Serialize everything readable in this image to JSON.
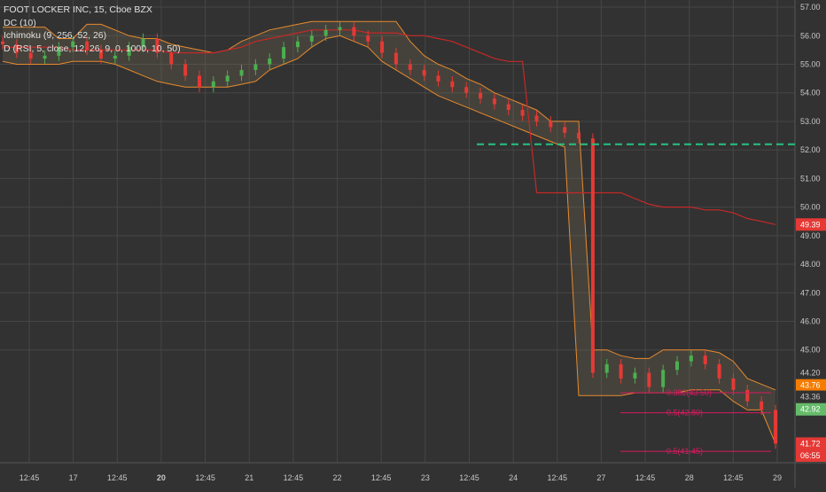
{
  "legend": {
    "title": "FOOT LOCKER INC, 15, Cboe BZX",
    "dc": "DC (10)",
    "ichimoku": "Ichimoku (9, 256, 52, 26)",
    "d": "D (RSI, 5, close, 12, 26, 9, 0, 1000, 10, 50)"
  },
  "colors": {
    "background": "#323232",
    "grid": "#464646",
    "candle_up": "#4caf50",
    "candle_down": "#e53935",
    "donchian": "#e88a2e",
    "ichimoku_line": "#c62828",
    "ichimoku_cloud": "#8a7a5a",
    "target_line": "#26c281",
    "fib": "#d81b60"
  },
  "chart_data": {
    "type": "line",
    "title": "FOOT LOCKER INC, 15, Cboe BZX",
    "ylim": [
      41.05,
      57.25
    ],
    "y_ticks": [
      "57.00",
      "56.00",
      "55.00",
      "54.00",
      "53.00",
      "52.00",
      "51.00",
      "50.00",
      "49.00",
      "48.00",
      "47.00",
      "46.00",
      "45.00",
      "44.20",
      "43.36",
      "41.72"
    ],
    "x_ticks": [
      "12:45",
      "17",
      "12:45",
      "20",
      "12:45",
      "21",
      "12:45",
      "22",
      "12:45",
      "23",
      "12:45",
      "24",
      "12:45",
      "27",
      "12:45",
      "28",
      "12:45",
      "29"
    ],
    "series": [
      {
        "key": "close",
        "values": [
          55.7,
          55.4,
          55.2,
          55.3,
          55.6,
          55.8,
          55.5,
          55.2,
          55.3,
          55.6,
          55.9,
          55.4,
          55.0,
          54.6,
          54.2,
          54.4,
          54.6,
          54.8,
          55.0,
          55.2,
          55.6,
          55.8,
          56.0,
          56.2,
          56.3,
          56.0,
          55.8,
          55.4,
          55.0,
          54.8,
          54.6,
          54.4,
          54.2,
          54.0,
          53.8,
          53.6,
          53.4,
          53.2,
          53.0,
          52.8,
          52.6,
          52.4,
          44.2,
          44.5,
          44.0,
          44.2,
          43.7,
          44.3,
          44.6,
          44.8,
          44.5,
          44.0,
          43.6,
          43.2,
          42.9,
          41.72
        ]
      },
      {
        "key": "donchian_upper",
        "values": [
          56.3,
          56.3,
          56.3,
          56.3,
          55.9,
          55.9,
          56.4,
          56.4,
          56.2,
          56.0,
          55.9,
          55.9,
          55.7,
          55.6,
          55.5,
          55.4,
          55.5,
          55.8,
          56.0,
          56.2,
          56.3,
          56.4,
          56.5,
          56.5,
          56.5,
          56.5,
          56.5,
          56.5,
          56.5,
          55.8,
          55.3,
          55.0,
          54.8,
          54.5,
          54.3,
          54.0,
          53.8,
          53.6,
          53.4,
          53.0,
          53.0,
          53.0,
          45.0,
          45.0,
          44.8,
          44.7,
          44.7,
          45.0,
          45.0,
          45.0,
          45.0,
          44.9,
          44.6,
          44.0,
          43.8,
          43.6
        ]
      },
      {
        "key": "donchian_lower",
        "values": [
          55.1,
          55.0,
          55.0,
          55.0,
          55.0,
          55.1,
          55.1,
          55.1,
          55.0,
          54.8,
          54.6,
          54.4,
          54.3,
          54.2,
          54.2,
          54.2,
          54.2,
          54.3,
          54.4,
          54.8,
          55.0,
          55.2,
          55.6,
          55.9,
          56.0,
          55.8,
          55.6,
          55.1,
          54.8,
          54.5,
          54.2,
          53.9,
          53.7,
          53.5,
          53.3,
          53.1,
          52.9,
          52.7,
          52.5,
          52.3,
          52.1,
          43.4,
          43.4,
          43.4,
          43.4,
          43.5,
          43.5,
          43.5,
          43.5,
          43.6,
          43.6,
          43.6,
          43.2,
          42.9,
          42.9,
          41.72
        ]
      },
      {
        "key": "ichimoku_line",
        "values": [
          55.6,
          55.6,
          55.6,
          55.6,
          55.6,
          55.5,
          55.5,
          55.5,
          55.5,
          55.5,
          55.5,
          55.5,
          55.4,
          55.4,
          55.4,
          55.4,
          55.5,
          55.6,
          55.8,
          55.9,
          56.0,
          56.1,
          56.2,
          56.2,
          56.2,
          56.2,
          56.1,
          56.1,
          56.1,
          56.0,
          56.0,
          55.9,
          55.8,
          55.6,
          55.4,
          55.2,
          55.1,
          55.1,
          50.5,
          50.5,
          50.5,
          50.5,
          50.5,
          50.5,
          50.5,
          50.3,
          50.1,
          50.0,
          50.0,
          50.0,
          49.9,
          49.9,
          49.8,
          49.6,
          49.5,
          49.39
        ]
      }
    ],
    "horizontal_levels": [
      {
        "name": "target",
        "value": 52.2
      },
      {
        "name": "fib_1",
        "value": 43.5,
        "label": "0.382(43.50)"
      },
      {
        "name": "fib_2",
        "value": 42.8,
        "label": "0.5(42.80)"
      },
      {
        "name": "fib_3",
        "value": 41.45,
        "label": "0.5(41.45)"
      }
    ],
    "price_tags": [
      {
        "value": 49.39,
        "label": "49.39",
        "color": "#e53935",
        "text": "#ffffff"
      },
      {
        "value": 43.76,
        "label": "43.76",
        "color": "#f57c00",
        "text": "#ffffff"
      },
      {
        "value": 43.36,
        "label": "43.36",
        "color": "#323232",
        "text": "#c8c8c8"
      },
      {
        "value": 42.92,
        "label": "42.92",
        "color": "#66bb6a",
        "text": "#ffffff"
      },
      {
        "value": 41.72,
        "label": "41.72",
        "color": "#e53935",
        "text": "#ffffff"
      },
      {
        "value": 41.3,
        "label": "06:55",
        "color": "#e53935",
        "text": "#ffffff"
      }
    ]
  }
}
